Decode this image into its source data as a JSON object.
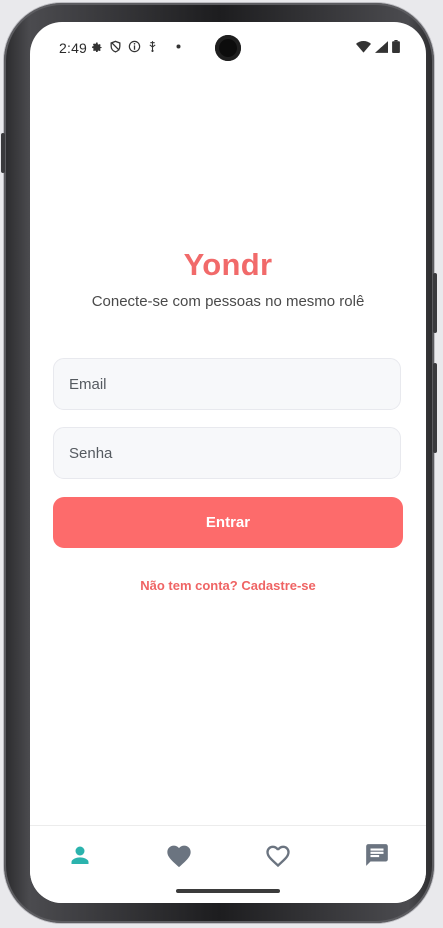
{
  "status_bar": {
    "time": "2:49",
    "left_icons": [
      "settings-icon",
      "shield-icon",
      "info-icon",
      "usb-icon",
      "dot-icon"
    ],
    "right_icons": [
      "wifi-icon",
      "signal-icon",
      "battery-icon"
    ]
  },
  "app": {
    "brand": "Yondr",
    "tagline": "Conecte-se com pessoas no mesmo rolê"
  },
  "form": {
    "email_placeholder": "Email",
    "email_value": "",
    "password_placeholder": "Senha",
    "password_value": "",
    "submit_label": "Entrar",
    "signup_link": "Não tem conta? Cadastre-se"
  },
  "bottom_nav": {
    "items": [
      {
        "icon": "person-icon",
        "active": true
      },
      {
        "icon": "heart-filled-icon",
        "active": false
      },
      {
        "icon": "heart-outline-icon",
        "active": false
      },
      {
        "icon": "chat-icon",
        "active": false
      }
    ]
  },
  "colors": {
    "brand": "#f16a6a",
    "button": "#fd6b6b",
    "nav_active": "#2bb3ad",
    "nav_inactive": "#6b7480"
  }
}
